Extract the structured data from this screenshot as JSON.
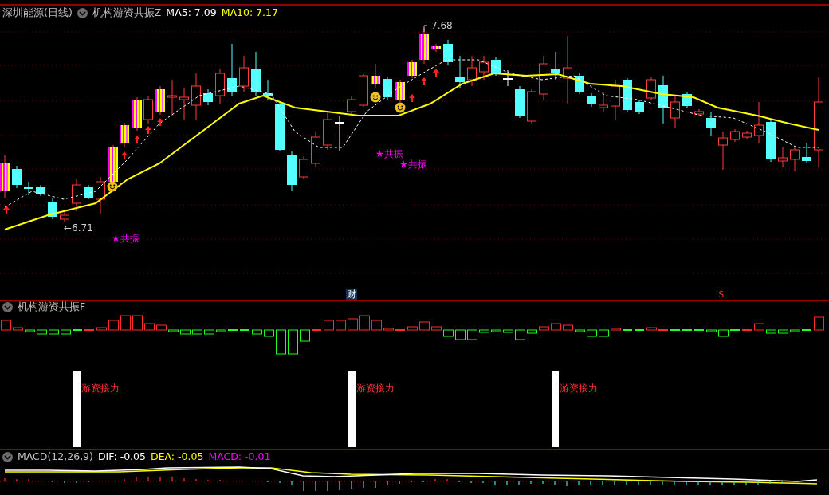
{
  "main_chart": {
    "security": "深圳能源(日线)",
    "indicator": "机构游资共振Z",
    "ma5": "MA5: 7.09",
    "ma10": "MA10: 7.17",
    "high_label": "7.68",
    "low_label": "←6.71",
    "signals": [
      "★共振",
      "★共振",
      "★共振"
    ],
    "events": [
      {
        "kind": "finance",
        "text": "财"
      },
      {
        "kind": "dividend",
        "text": "$"
      }
    ]
  },
  "sub_chart": {
    "title": "机构游资共振F",
    "relay_labels": [
      "游资接力",
      "游资接力",
      "游资接力"
    ]
  },
  "macd_chart": {
    "title": "MACD(12,26,9)",
    "dif": "DIF: -0.05",
    "dea": "DEA: -0.05",
    "macd": "MACD: -0.01"
  }
}
